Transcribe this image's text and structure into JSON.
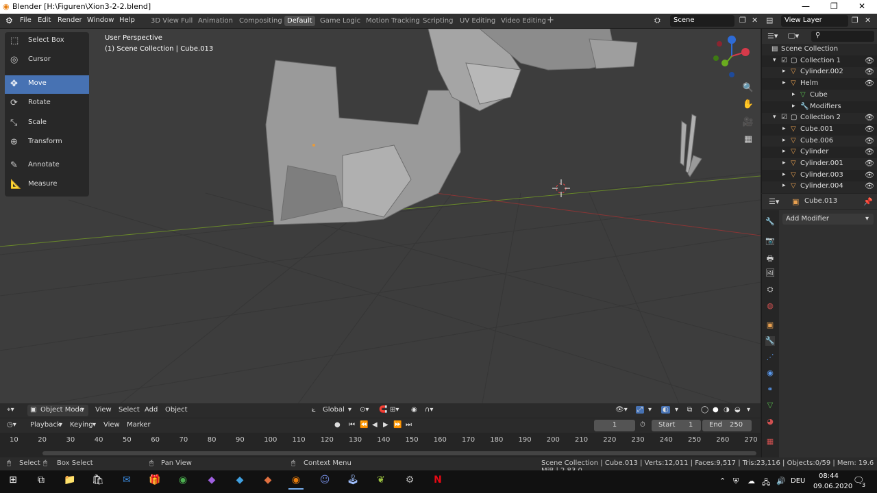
{
  "window": {
    "title": "Blender [H:\\Figuren\\Xion3-2-2.blend]",
    "min": "—",
    "max": "❐",
    "close": "✕"
  },
  "menu": [
    "File",
    "Edit",
    "Render",
    "Window",
    "Help"
  ],
  "workspaces": [
    "3D View Full",
    "Animation",
    "Compositing",
    "Default",
    "Game Logic",
    "Motion Tracking",
    "Scripting",
    "UV Editing",
    "Video Editing"
  ],
  "active_workspace": "Default",
  "scene": {
    "label": "Scene",
    "view_layer": "View Layer"
  },
  "tools": [
    "Select Box",
    "Cursor",
    "Move",
    "Rotate",
    "Scale",
    "Transform",
    "Annotate",
    "Measure"
  ],
  "active_tool": "Move",
  "viewport": {
    "perspective": "User Perspective",
    "collection_info": "(1) Scene Collection | Cube.013"
  },
  "header3d": {
    "mode": "Object Mode",
    "view": "View",
    "select": "Select",
    "add": "Add",
    "object": "Object",
    "orientation": "Global"
  },
  "timeline": {
    "playback": "Playback",
    "keying": "Keying",
    "view": "View",
    "marker": "Marker",
    "current_frame": "1",
    "start_label": "Start",
    "start": "1",
    "end_label": "End",
    "end": "250",
    "ticks": [
      "10",
      "20",
      "30",
      "40",
      "50",
      "60",
      "70",
      "80",
      "90",
      "100",
      "110",
      "120",
      "130",
      "140",
      "150",
      "160",
      "170",
      "180",
      "190",
      "200",
      "210",
      "220",
      "230",
      "240",
      "250",
      "260",
      "270"
    ]
  },
  "outliner": {
    "items": [
      {
        "label": "Scene Collection",
        "level": 0
      },
      {
        "label": "Collection 1",
        "level": 1
      },
      {
        "label": "Cylinder.002",
        "level": 2
      },
      {
        "label": "Helm",
        "level": 2
      },
      {
        "label": "Cube",
        "level": 3
      },
      {
        "label": "Modifiers",
        "level": 3
      },
      {
        "label": "Collection 2",
        "level": 1
      },
      {
        "label": "Cube.001",
        "level": 2
      },
      {
        "label": "Cube.006",
        "level": 2
      },
      {
        "label": "Cylinder",
        "level": 2
      },
      {
        "label": "Cylinder.001",
        "level": 2
      },
      {
        "label": "Cylinder.003",
        "level": 2
      },
      {
        "label": "Cylinder.004",
        "level": 2
      }
    ]
  },
  "properties": {
    "object_name": "Cube.013",
    "add_modifier": "Add Modifier"
  },
  "status": {
    "select": "Select",
    "box_select": "Box Select",
    "pan_view": "Pan View",
    "context_menu": "Context Menu",
    "stats": "Scene Collection | Cube.013 | Verts:12,011 | Faces:9,517 | Tris:23,116 | Objects:0/59 | Mem: 19.6 MiB | 2.83.0"
  },
  "taskbar": {
    "lang": "DEU",
    "time": "08:44",
    "date": "09.06.2020",
    "notifications": "3"
  },
  "colors": {
    "accent": "#4772b3",
    "grid": "#3d3d3d",
    "x_axis": "#b33e3e",
    "y_axis": "#6a8a2a"
  }
}
